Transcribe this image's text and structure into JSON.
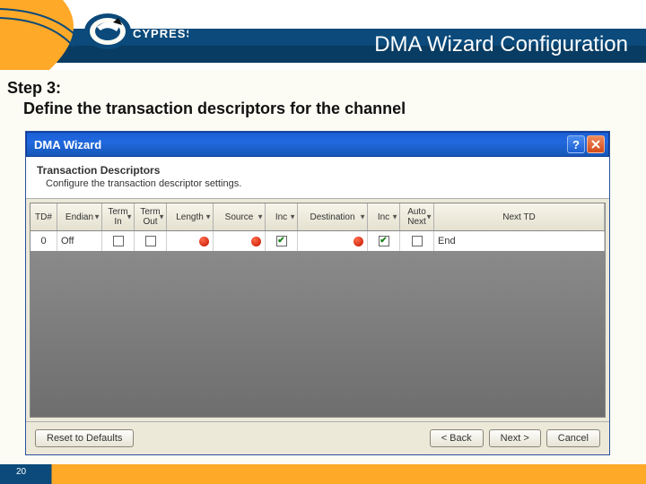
{
  "slide": {
    "title": "DMA Wizard Configuration",
    "brand": "CYPRESS",
    "page_number": "20"
  },
  "step": {
    "label": "Step 3:",
    "text": "Define the transaction descriptors for the channel"
  },
  "wizard": {
    "title": "DMA Wizard",
    "banner_title": "Transaction Descriptors",
    "banner_sub": "Configure the transaction descriptor settings.",
    "columns": [
      "TD#",
      "Endian",
      "Term In",
      "Term Out",
      "Length",
      "Source",
      "Inc",
      "Destination",
      "Inc",
      "Auto Next",
      "Next TD"
    ],
    "row": {
      "td_num": "0",
      "endian": "Off",
      "term_in_checked": false,
      "term_out_checked": false,
      "length_warn": true,
      "source_warn": true,
      "inc1_checked": true,
      "dest_warn": true,
      "inc2_checked": true,
      "auto_next_checked": false,
      "next_td": "End"
    },
    "buttons": {
      "reset": "Reset to Defaults",
      "back": "< Back",
      "next": "Next >",
      "cancel": "Cancel"
    }
  }
}
